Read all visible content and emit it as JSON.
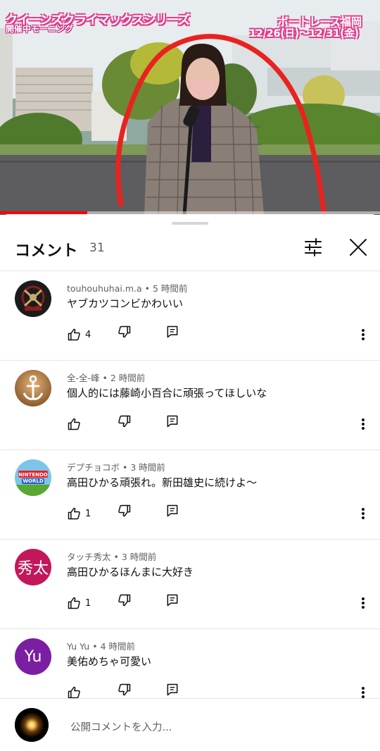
{
  "video": {
    "overlay_title": "クイーンズクライマックスシリーズ",
    "overlay_subtitle": "開催中モーニング",
    "overlay_venue": "ボートレース福岡",
    "overlay_dates": "12/26(日)～12/31(金)",
    "progress_fraction": 0.23,
    "accent_color": "#ff0000"
  },
  "sheet": {
    "title": "コメント",
    "count": "31",
    "filter_icon": "sliders-icon",
    "close_icon": "close-icon"
  },
  "comments": [
    {
      "author": "touhouhuhai.m.a",
      "time": "5 時間前",
      "text": "ヤブカツコンビかわいい",
      "likes": "4",
      "avatar": "emblem"
    },
    {
      "author": "全-全-峰",
      "time": "2 時間前",
      "text": "個人的には藤崎小百合に頑張ってほしいな",
      "likes": "",
      "avatar": "anchor"
    },
    {
      "author": "デプチョコボ",
      "time": "3 時間前",
      "text": "高田ひかる頑張れ。新田雄史に続けよ〜",
      "likes": "1",
      "avatar": "nintendo-world"
    },
    {
      "author": "タッチ秀太",
      "time": "3 時間前",
      "text": "高田ひかるほんまに大好き",
      "likes": "1",
      "avatar_text": "秀太",
      "avatar_color": "#c2185b"
    },
    {
      "author": "Yu Yu",
      "time": "4 時間前",
      "text": "美佑めちゃ可愛い",
      "likes": "",
      "avatar_text": "Yu",
      "avatar_color": "#7b1fa2"
    }
  ],
  "input": {
    "placeholder": "公開コメントを入力..."
  }
}
